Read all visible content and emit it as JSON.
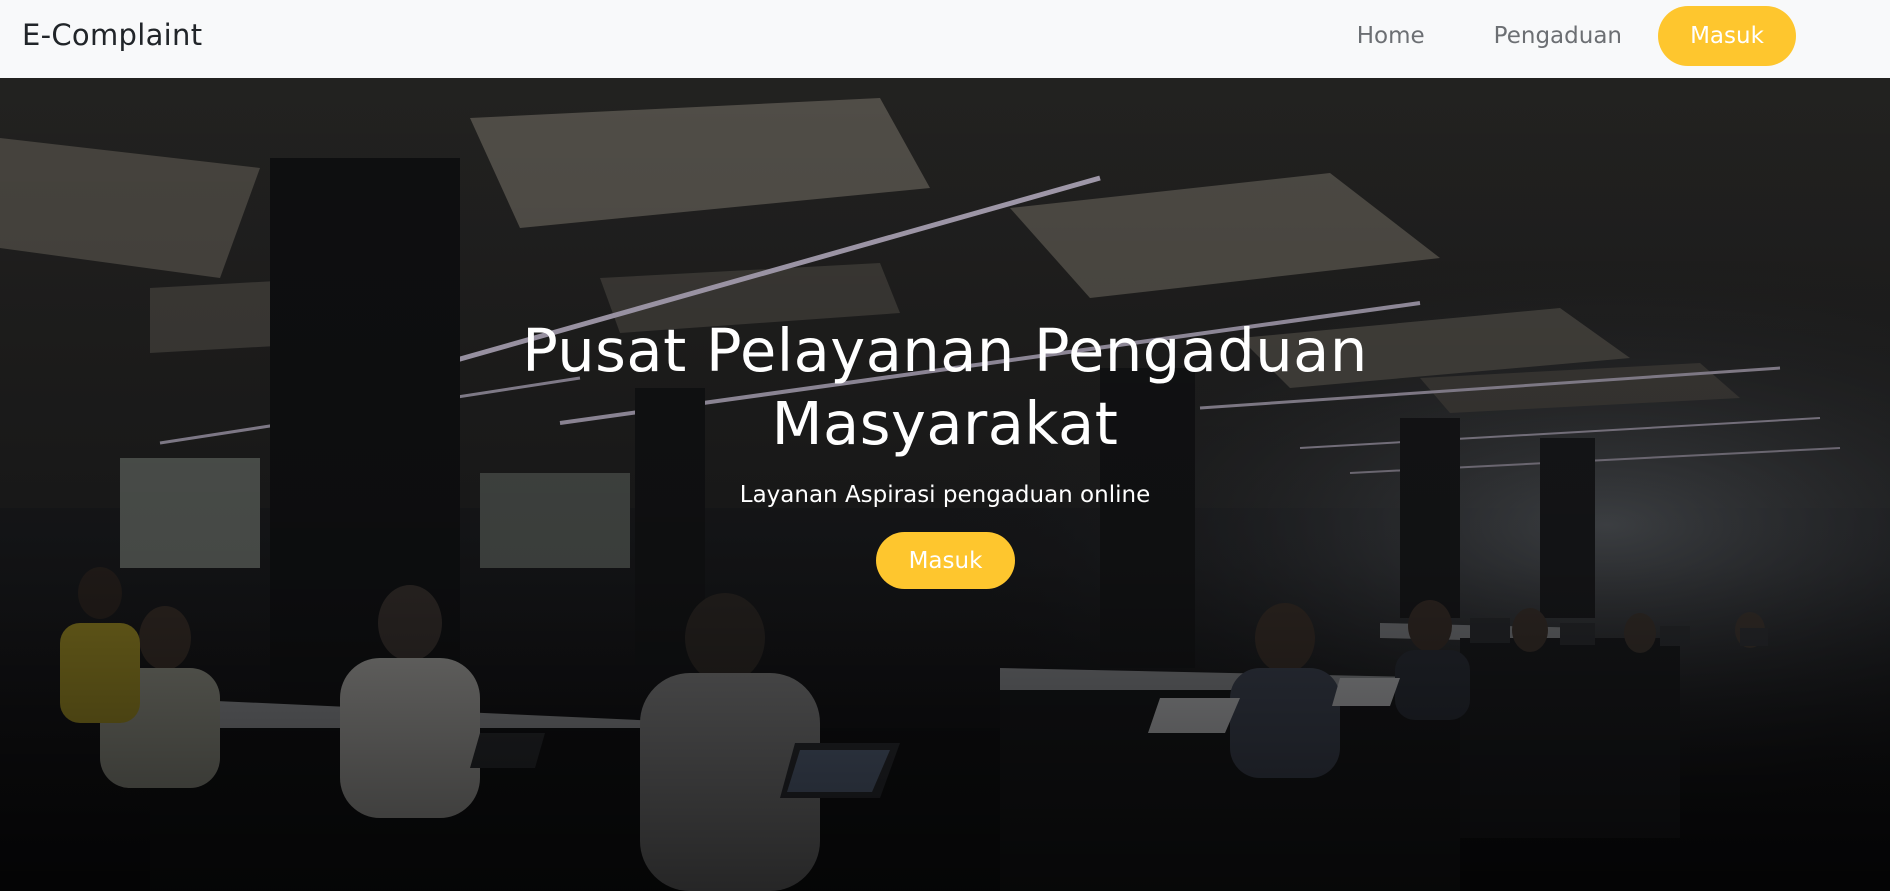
{
  "navbar": {
    "brand": "E-Complaint",
    "links": [
      "Home",
      "Pengaduan"
    ],
    "login_label": "Masuk"
  },
  "hero": {
    "title": "Pusat Pelayanan Pengaduan Masyarakat",
    "subtitle": "Layanan Aspirasi pengaduan online",
    "cta_label": "Masuk"
  },
  "colors": {
    "accent": "#fec62e",
    "navbar_bg": "#f8f9fa",
    "hero_overlay": "#000000"
  }
}
